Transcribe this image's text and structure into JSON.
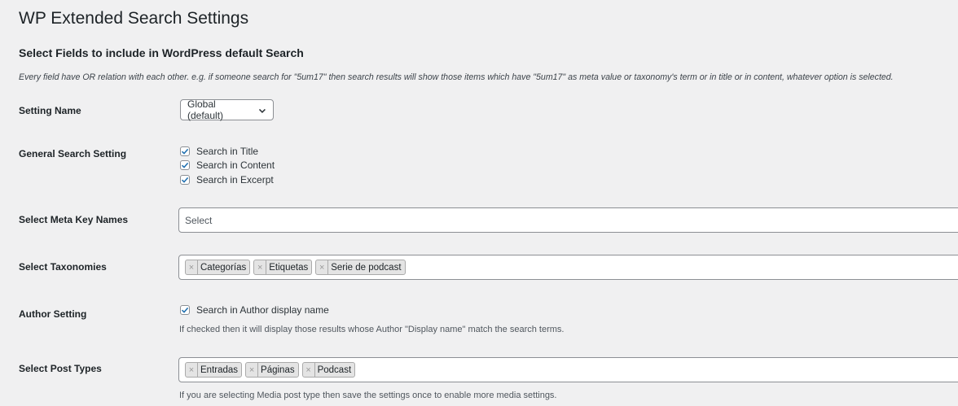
{
  "page_title": "WP Extended Search Settings",
  "section_title": "Select Fields to include in WordPress default Search",
  "description": "Every field have OR relation with each other. e.g. if someone search for \"5um17\" then search results will show those items which have \"5um17\" as meta value or taxonomy's term or in title or in content, whatever option is selected.",
  "setting_name": {
    "label": "Setting Name",
    "selected": "Global (default)"
  },
  "general": {
    "label": "General Search Setting",
    "options": [
      {
        "label": "Search in Title",
        "checked": true
      },
      {
        "label": "Search in Content",
        "checked": true
      },
      {
        "label": "Search in Excerpt",
        "checked": true
      }
    ]
  },
  "meta_keys": {
    "label": "Select Meta Key Names",
    "placeholder": "Select"
  },
  "taxonomies": {
    "label": "Select Taxonomies",
    "tags": [
      "Categorías",
      "Etiquetas",
      "Serie de podcast"
    ]
  },
  "author": {
    "label": "Author Setting",
    "option": "Search in Author display name",
    "checked": true,
    "help": "If checked then it will display those results whose Author \"Display name\" match the search terms."
  },
  "post_types": {
    "label": "Select Post Types",
    "tags": [
      "Entradas",
      "Páginas",
      "Podcast"
    ],
    "help": "If you are selecting Media post type then save the settings once to enable more media settings."
  },
  "colors": {
    "background": "#f0f0f1",
    "checkmark": "#2271b1",
    "tag_bg": "#e4e4e4"
  }
}
